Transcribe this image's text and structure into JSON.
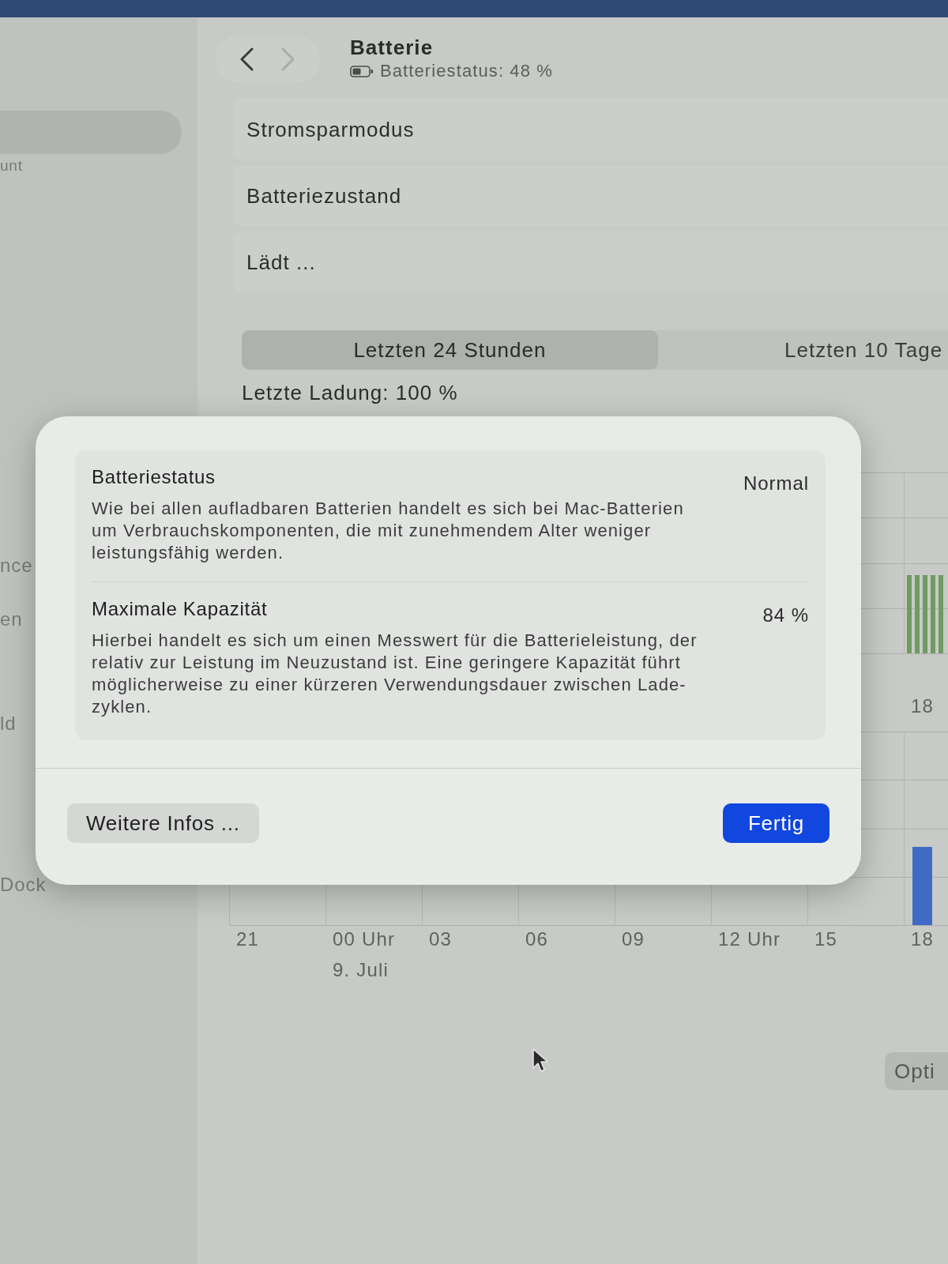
{
  "sidebar": {
    "items": [
      {
        "selected": true
      },
      {
        "label": "unt",
        "selected": false
      },
      {
        "label": "nce",
        "selected": false
      },
      {
        "label": "en",
        "selected": false
      },
      {
        "label": "ld",
        "selected": false
      },
      {
        "label": "Dock",
        "selected": false
      }
    ]
  },
  "toolbar": {
    "back_enabled": true,
    "forward_enabled": false,
    "title": "Batterie",
    "subtitle": "Batteriestatus: 48 %"
  },
  "rows": [
    {
      "label": "Stromsparmodus"
    },
    {
      "label": "Batteriezustand"
    },
    {
      "label": "Lädt ..."
    }
  ],
  "range_tabs": [
    {
      "label": "Letzten 24 Stunden",
      "selected": true
    },
    {
      "label": "Letzten 10 Tage",
      "selected": false
    }
  ],
  "last_charge": "Letzte Ladung: 100 %",
  "level_chart": {
    "x_labels": [
      "18"
    ]
  },
  "usage_chart": {
    "x_labels": [
      "21",
      "00 Uhr",
      "03",
      "06",
      "09",
      "12 Uhr",
      "15",
      "18"
    ],
    "date_label": "9. Juli"
  },
  "options_button": "Opti",
  "dialog": {
    "rows": [
      {
        "title": "Batteriestatus",
        "value": "Normal",
        "description": "Wie bei allen aufladbaren Batterien handelt es sich bei Mac-Batterien\num Verbrauchskomponenten, die mit zunehmendem Alter weniger\nleistungsfähig werden."
      },
      {
        "title": "Maximale Kapazität",
        "value": "84 %",
        "description": "Hierbei handelt es sich um einen Messwert für die Batterieleistung, der\nrelativ zur Leistung im Neuzustand ist. Eine geringere Kapazität führt\nmöglicherweise zu einer kürzeren Verwendungsdauer zwischen Lade-\nzyklen."
      }
    ],
    "buttons": [
      {
        "label": "Weitere Infos ...",
        "kind": "secondary"
      },
      {
        "label": "Fertig",
        "kind": "primary"
      }
    ]
  }
}
